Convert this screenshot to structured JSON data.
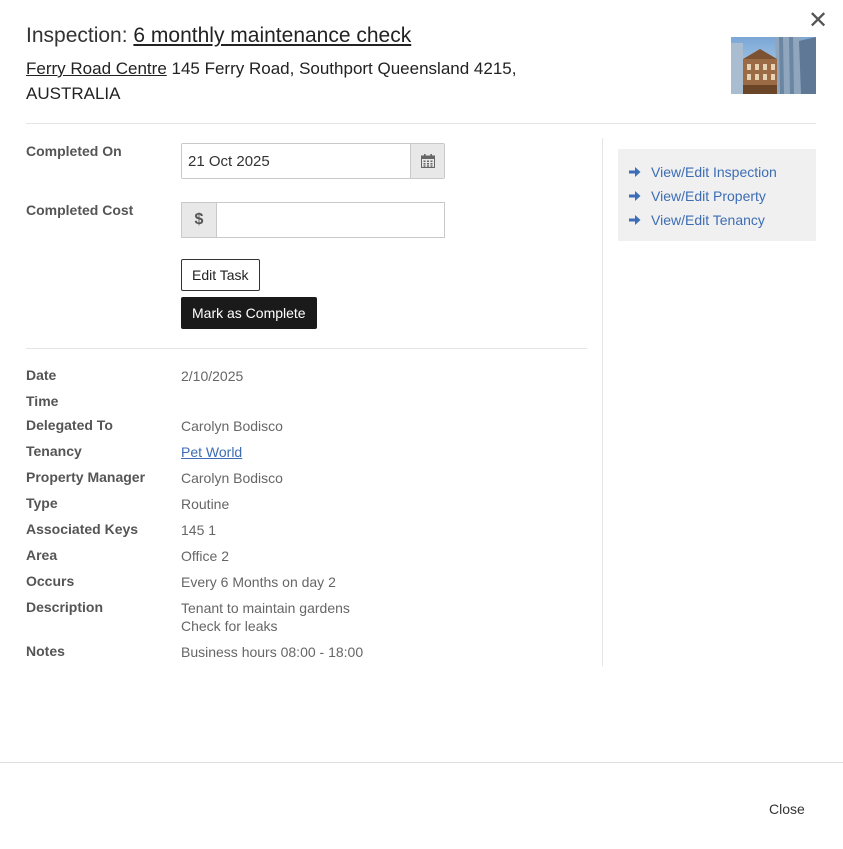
{
  "header": {
    "title_prefix": "Inspection: ",
    "title_link": "6 monthly maintenance check",
    "property_link": "Ferry Road Centre",
    "address": " 145 Ferry Road, Southport Queensland 4215, AUSTRALIA"
  },
  "form": {
    "completed_on_label": "Completed On",
    "completed_on_value": "21 Oct 2025",
    "completed_cost_label": "Completed Cost",
    "currency_symbol": "$",
    "completed_cost_value": "",
    "edit_task_label": "Edit Task",
    "mark_complete_label": "Mark as Complete"
  },
  "links": [
    {
      "label": "View/Edit Inspection",
      "icon": "arrow-right-icon"
    },
    {
      "label": "View/Edit Property",
      "icon": "arrow-right-icon"
    },
    {
      "label": "View/Edit Tenancy",
      "icon": "arrow-right-icon"
    }
  ],
  "details": {
    "date": {
      "label": "Date",
      "value": "2/10/2025"
    },
    "time": {
      "label": "Time",
      "value": ""
    },
    "delegated_to": {
      "label": "Delegated To",
      "value": "Carolyn Bodisco"
    },
    "tenancy": {
      "label": "Tenancy",
      "value": "Pet World"
    },
    "property_manager": {
      "label": "Property Manager",
      "value": "Carolyn Bodisco"
    },
    "type": {
      "label": "Type",
      "value": "Routine"
    },
    "associated_keys": {
      "label": "Associated Keys",
      "value": "145 1"
    },
    "area": {
      "label": "Area",
      "value": "Office 2"
    },
    "occurs": {
      "label": "Occurs",
      "value": "Every 6 Months on day 2"
    },
    "description": {
      "label": "Description",
      "line1": "Tenant to maintain gardens",
      "line2": "Check for leaks"
    },
    "notes": {
      "label": "Notes",
      "value": "Business hours 08:00 - 18:00"
    }
  },
  "footer": {
    "close_label": "Close"
  },
  "colors": {
    "link_blue": "#3d6db5",
    "primary_button": "#1a1a1a"
  },
  "icons": {
    "close": "close-icon",
    "calendar": "calendar-icon",
    "property_photo": "property-photo"
  }
}
